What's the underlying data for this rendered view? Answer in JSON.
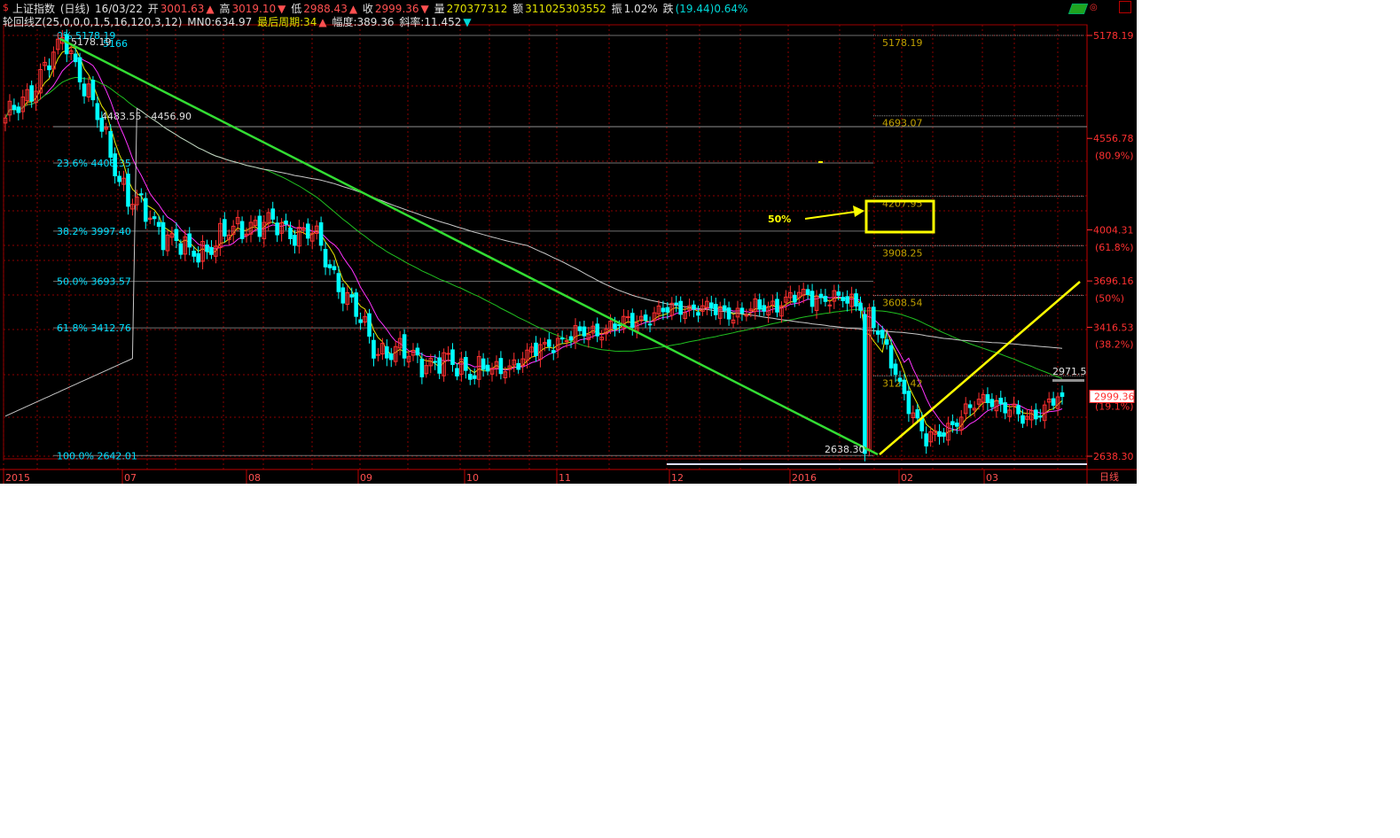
{
  "header": {
    "name": "上证指数",
    "period": "(日线)",
    "date": "16/03/22",
    "open_label": "开",
    "open": "3001.63",
    "high_label": "高",
    "high": "3019.10",
    "low_label": "低",
    "low": "2988.43",
    "close_label": "收",
    "close": "2999.36",
    "vol_label": "量",
    "vol": "270377312",
    "amt_label": "额",
    "amt": "311025303552",
    "amp_label": "振",
    "amp": "1.02%",
    "chg_label": "跌",
    "chg": "(19.44)0.64%"
  },
  "indicator": {
    "name": "轮回线Z(25,0,0,0,1,5,16,120,3,12)",
    "mn": "MN0:634.97",
    "cycle": "最后周期:34",
    "range": "幅度:389.36",
    "slope": "斜率:11.452"
  },
  "toolbar": {
    "money_icon": "money-icon",
    "settings_icon": "gear-icon",
    "close_icon": "close-icon"
  },
  "colors": {
    "background": "#000000",
    "up": "#ff3030",
    "down": "#00ffff",
    "ma5": "#e8e800",
    "ma10": "#ff33ff",
    "ma60": "#20c020",
    "ma120": "#c8c8c8",
    "trend": "#33dd33",
    "highlight": "#ffff00",
    "grid": "#8b0000",
    "price_axis": "#ff3030"
  },
  "chart_data": {
    "type": "candlestick",
    "title": "上证指数 (日线)",
    "period": "日线",
    "ylim": [
      2560,
      5260
    ],
    "price_ticks": [
      5178.19,
      4556.78,
      4004.31,
      3696.16,
      3416.53,
      2638.3
    ],
    "price_tick_labels": [
      "5178.19",
      "4556.78",
      "4004.31",
      "3696.16",
      "3416.53",
      "2638.30"
    ],
    "pct_labels": [
      {
        "value": 4454,
        "label": "(80.9%)"
      },
      {
        "value": 3900,
        "label": "(61.8%)"
      },
      {
        "value": 3594,
        "label": "(50%)"
      },
      {
        "value": 3314,
        "label": "(38.2%)"
      },
      {
        "value": 2940,
        "label": "(19.1%)"
      }
    ],
    "current_price": "2999.36",
    "last_close_marker": "2971.5",
    "x_labels": [
      "2015",
      "07",
      "08",
      "09",
      "10",
      "11",
      "12",
      "2016",
      "02",
      "03"
    ],
    "x_axis_unit": "日线",
    "fib_left": [
      {
        "label": "0%",
        "value": "5178.19",
        "extra": "5166",
        "price": 5178.19
      },
      {
        "label": "23.6%",
        "value": "4408.35",
        "price": 4408.35
      },
      {
        "label": "38.2%",
        "value": "3997.40",
        "price": 3997.4
      },
      {
        "label": "50.0%",
        "value": "3693.57",
        "price": 3693.57
      },
      {
        "label": "61.8%",
        "value": "3412.76",
        "price": 3412.76
      },
      {
        "label": "100.0%",
        "value": "2642.01",
        "price": 2642.01
      }
    ],
    "fib_right": [
      "5178.19",
      "4693.07",
      "4207.95",
      "3908.25",
      "3608.54",
      "3123.42"
    ],
    "range_label": "4483.55 - 4456.90",
    "high_mark": "5178.19",
    "low_mark": "2638.30",
    "annotation_50": "50%",
    "highlight_box": "3908.25",
    "indices": [
      0,
      14,
      28,
      42,
      56,
      70,
      84,
      98,
      112,
      126,
      140,
      154,
      168,
      182,
      196,
      210,
      224,
      232,
      241
    ],
    "close_anchors": [
      4650,
      5150,
      4200,
      3850,
      4050,
      3980,
      3300,
      3200,
      3150,
      3340,
      3430,
      3540,
      3500,
      3610,
      3560,
      2720,
      3000,
      2860,
      2999
    ],
    "trendlines": [
      {
        "from": [
          13,
          5178
        ],
        "to": [
          196,
          2638
        ],
        "color": "green"
      },
      {
        "from": [
          196,
          2638
        ],
        "to": [
          241,
          3530
        ],
        "color": "yellow"
      }
    ],
    "moving_averages": [
      {
        "name": "MA5",
        "color": "#e8e800"
      },
      {
        "name": "MA10",
        "color": "#ff33ff"
      },
      {
        "name": "MA60",
        "color": "#20c020"
      },
      {
        "name": "MA120",
        "color": "#c8c8c8"
      }
    ]
  }
}
